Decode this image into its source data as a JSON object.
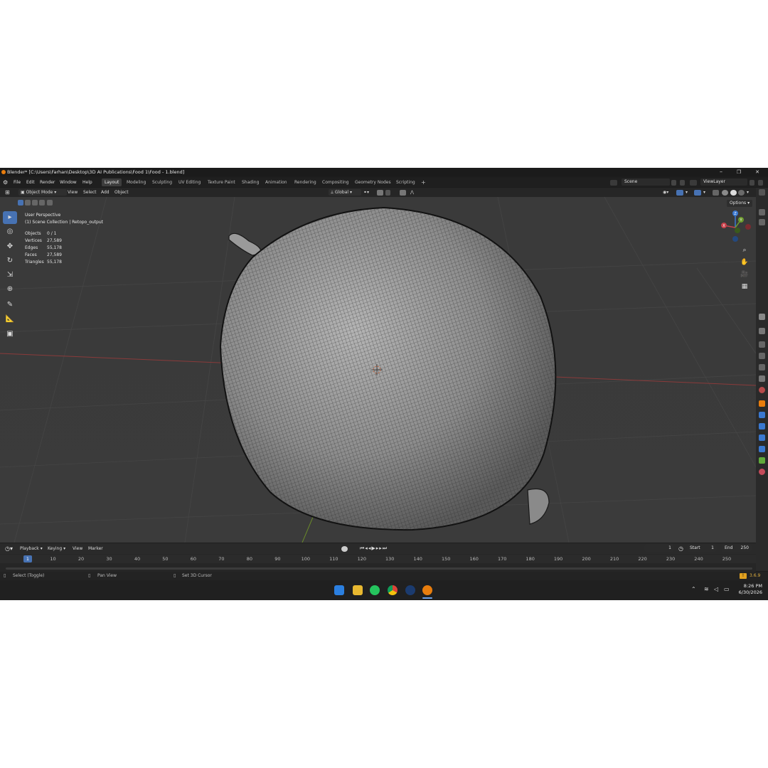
{
  "window": {
    "title": "Blender* [C:\\Users\\Farhan\\Desktop\\3D AI Publications\\Food 1\\Food - 1.blend]",
    "minimize": "–",
    "maximize": "❐",
    "close": "✕"
  },
  "menu": {
    "items": [
      "File",
      "Edit",
      "Render",
      "Window",
      "Help"
    ],
    "workspaces": [
      "Layout",
      "Modeling",
      "Sculpting",
      "UV Editing",
      "Texture Paint",
      "Shading",
      "Animation",
      "Rendering",
      "Compositing",
      "Geometry Nodes",
      "Scripting"
    ],
    "active_workspace": "Layout",
    "add_tab": "+",
    "scene": "Scene",
    "view_layer": "ViewLayer"
  },
  "header3d": {
    "mode": "Object Mode",
    "menus": [
      "View",
      "Select",
      "Add",
      "Object"
    ],
    "orientation": "Global",
    "options": "Options"
  },
  "viewport": {
    "perspective": "User Perspective",
    "collection": "(1) Scene Collection | Retopo_output",
    "stats": [
      {
        "label": "Objects",
        "value": "0 / 1"
      },
      {
        "label": "Vertices",
        "value": "27,589"
      },
      {
        "label": "Edges",
        "value": "55,178"
      },
      {
        "label": "Faces",
        "value": "27,589"
      },
      {
        "label": "Triangles",
        "value": "55,178"
      }
    ],
    "gizmo": {
      "x": "X",
      "y": "Y",
      "z": "Z"
    }
  },
  "timeline": {
    "menus": [
      "Playback",
      "Keying",
      "View",
      "Marker"
    ],
    "current_frame": "1",
    "start_label": "Start",
    "start": "1",
    "end_label": "End",
    "end": "250",
    "ticks": [
      "1",
      "10",
      "20",
      "30",
      "40",
      "50",
      "60",
      "70",
      "80",
      "90",
      "100",
      "110",
      "120",
      "130",
      "140",
      "150",
      "160",
      "170",
      "180",
      "190",
      "200",
      "210",
      "220",
      "230",
      "240",
      "250"
    ]
  },
  "statusbar": {
    "hint1": "Select (Toggle)",
    "hint2": "Pan View",
    "hint3": "Set 3D Cursor",
    "version": "3.6.9"
  },
  "taskbar": {
    "apps": [
      "windows-start-icon",
      "file-explorer-icon",
      "whatsapp-icon",
      "chrome-icon",
      "steam-icon",
      "blender-icon"
    ],
    "time": "8:26 PM",
    "date": "6/30/2026"
  },
  "colors": {
    "accent": "#4772b3",
    "blender_orange": "#e87d0d",
    "x_axis": "#c8414b",
    "y_axis": "#6c9a2c",
    "z_axis": "#3a78d0"
  }
}
